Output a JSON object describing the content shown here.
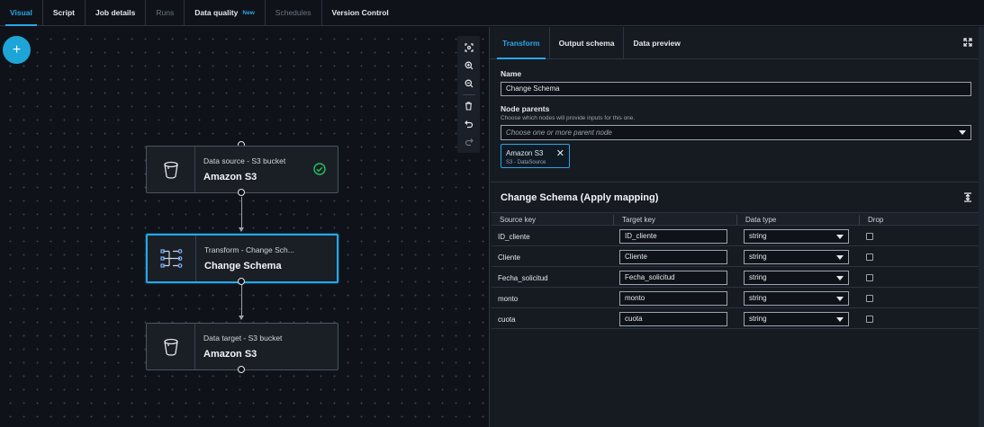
{
  "topbar": {
    "tabs": [
      {
        "label": "Visual",
        "state": "active"
      },
      {
        "label": "Script",
        "state": "normal"
      },
      {
        "label": "Job details",
        "state": "normal"
      },
      {
        "label": "Runs",
        "state": "disabled"
      },
      {
        "label": "Data quality",
        "state": "normal",
        "badge": "New"
      },
      {
        "label": "Schedules",
        "state": "disabled"
      },
      {
        "label": "Version Control",
        "state": "normal"
      }
    ]
  },
  "canvas": {
    "add_button": "+",
    "nodes": [
      {
        "subtitle": "Data source - S3 bucket",
        "title": "Amazon S3",
        "icon": "bucket-icon",
        "status": "check-circle-icon"
      },
      {
        "subtitle": "Transform - Change Sch...",
        "title": "Change Schema",
        "icon": "transform-icon",
        "selected": true
      },
      {
        "subtitle": "Data target - S3 bucket",
        "title": "Amazon S3",
        "icon": "bucket-icon"
      }
    ],
    "tools": [
      "fit-view-icon",
      "zoom-in-icon",
      "zoom-out-icon",
      "delete-icon",
      "undo-icon",
      "redo-icon"
    ]
  },
  "panel": {
    "tabs": [
      {
        "label": "Transform",
        "active": true
      },
      {
        "label": "Output schema",
        "active": false
      },
      {
        "label": "Data preview",
        "active": false
      }
    ],
    "name_label": "Name",
    "name_value": "Change Schema",
    "parents_label": "Node parents",
    "parents_hint": "Choose which nodes will provide inputs for this one.",
    "parents_placeholder": "Choose one or more parent node",
    "token": {
      "title": "Amazon S3",
      "subtitle": "S3 - DataSource"
    },
    "mapping": {
      "title": "Change Schema (Apply mapping)",
      "columns": [
        "Source key",
        "Target key",
        "Data type",
        "Drop"
      ],
      "rows": [
        {
          "source": "ID_cliente",
          "target": "ID_cliente",
          "type": "string",
          "drop": false
        },
        {
          "source": "Cliente",
          "target": "Cliente",
          "type": "string",
          "drop": false
        },
        {
          "source": "Fecha_solicitud",
          "target": "Fecha_solicitud",
          "type": "string",
          "drop": false
        },
        {
          "source": "monto",
          "target": "monto",
          "type": "string",
          "drop": false
        },
        {
          "source": "cuota",
          "target": "cuota",
          "type": "string",
          "drop": false
        }
      ]
    }
  },
  "colors": {
    "accent": "#2aa6e6",
    "success": "#22c55e",
    "background": "#0f1319",
    "panel": "#161b22"
  }
}
